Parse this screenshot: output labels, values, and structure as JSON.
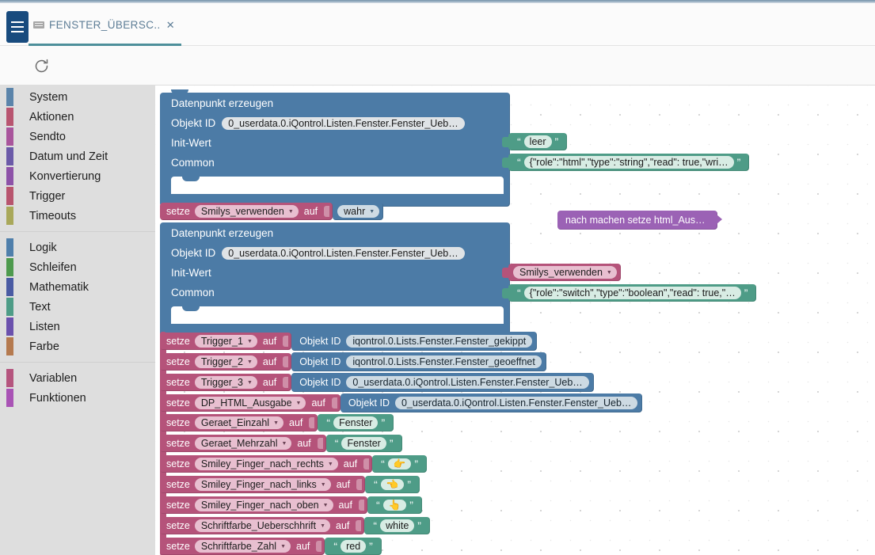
{
  "header": {
    "menu_icon": "hamburger-icon",
    "tab_icon": "script-file-icon",
    "tab_label": "FENSTER_ÜBERSC..",
    "tab_close": "✕",
    "accent_color": "#4d8f9a",
    "menu_color": "#184b7e"
  },
  "toolbar": {
    "refresh_icon": "refresh-icon",
    "refresh_title": "Neu laden"
  },
  "palette": {
    "groups": [
      {
        "items": [
          {
            "label": "System",
            "color": "#5b84aa"
          },
          {
            "label": "Aktionen",
            "color": "#b85570"
          },
          {
            "label": "Sendto",
            "color": "#a9559c"
          },
          {
            "label": "Datum und Zeit",
            "color": "#6b5aa8"
          },
          {
            "label": "Konvertierung",
            "color": "#8d52a8"
          },
          {
            "label": "Trigger",
            "color": "#b8556e"
          },
          {
            "label": "Timeouts",
            "color": "#a9a85a"
          }
        ]
      },
      {
        "items": [
          {
            "label": "Logik",
            "color": "#4f7fab"
          },
          {
            "label": "Schleifen",
            "color": "#4e9a4e"
          },
          {
            "label": "Mathematik",
            "color": "#4a5ba3"
          },
          {
            "label": "Text",
            "color": "#4e9c87"
          },
          {
            "label": "Listen",
            "color": "#6b51ad"
          },
          {
            "label": "Farbe",
            "color": "#b57a4f"
          }
        ]
      },
      {
        "items": [
          {
            "label": "Variablen",
            "color": "#b5557e"
          },
          {
            "label": "Funktionen",
            "color": "#a953b5"
          }
        ]
      }
    ]
  },
  "canvas": {
    "datapoint_block_1": {
      "title": "Datenpunkt erzeugen",
      "rows": [
        {
          "label": "Objekt ID",
          "value": "0_userdata.0.iQontrol.Listen.Fenster.Fenster_Ueb…"
        },
        {
          "label": "Init-Wert",
          "value": ""
        },
        {
          "label": "Common",
          "value": ""
        }
      ],
      "init_value_string": "leer",
      "common_string": "{\"role\":\"html\",\"type\":\"string\",\"read\": true,\"wri…"
    },
    "set_smilys": {
      "keyword": "setze",
      "variable": "Smilys_verwenden",
      "connector": "auf",
      "value": "wahr"
    },
    "on_change_block": {
      "label": "nach machen  setze html_Aus…"
    },
    "datapoint_block_2": {
      "title": "Datenpunkt erzeugen",
      "rows": [
        {
          "label": "Objekt ID",
          "value": "0_userdata.0.iQontrol.Listen.Fenster.Fenster_Ueb…"
        },
        {
          "label": "Init-Wert",
          "value": ""
        },
        {
          "label": "Common",
          "value": ""
        }
      ],
      "init_value_variable": "Smilys_verwenden",
      "common_string": "{\"role\":\"switch\",\"type\":\"boolean\",\"read\": true,\"…"
    },
    "assignments": [
      {
        "keyword": "setze",
        "variable": "Trigger_1",
        "connector": "auf",
        "value_kind": "object-id",
        "object_label": "Objekt ID",
        "value": "iqontrol.0.Lists.Fenster.Fenster_gekippt"
      },
      {
        "keyword": "setze",
        "variable": "Trigger_2",
        "connector": "auf",
        "value_kind": "object-id",
        "object_label": "Objekt ID",
        "value": "iqontrol.0.Lists.Fenster.Fenster_geoeffnet"
      },
      {
        "keyword": "setze",
        "variable": "Trigger_3",
        "connector": "auf",
        "value_kind": "object-id",
        "object_label": "Objekt ID",
        "value": "0_userdata.0.iQontrol.Listen.Fenster.Fenster_Ueb…"
      },
      {
        "keyword": "setze",
        "variable": "DP_HTML_Ausgabe",
        "connector": "auf",
        "value_kind": "object-id",
        "object_label": "Objekt ID",
        "value": "0_userdata.0.iQontrol.Listen.Fenster.Fenster_Ueb…"
      },
      {
        "keyword": "setze",
        "variable": "Geraet_Einzahl",
        "connector": "auf",
        "value_kind": "string",
        "value": "Fenster"
      },
      {
        "keyword": "setze",
        "variable": "Geraet_Mehrzahl",
        "connector": "auf",
        "value_kind": "string",
        "value": "Fenster"
      },
      {
        "keyword": "setze",
        "variable": "Smiley_Finger_nach_rechts",
        "connector": "auf",
        "value_kind": "string",
        "value": "👉"
      },
      {
        "keyword": "setze",
        "variable": "Smiley_Finger_nach_links",
        "connector": "auf",
        "value_kind": "string",
        "value": "👈"
      },
      {
        "keyword": "setze",
        "variable": "Smiley_Finger_nach_oben",
        "connector": "auf",
        "value_kind": "string",
        "value": "👆"
      },
      {
        "keyword": "setze",
        "variable": "Schriftfarbe_Ueberschhrift",
        "connector": "auf",
        "value_kind": "string",
        "value": "white"
      },
      {
        "keyword": "setze",
        "variable": "Schriftfarbe_Zahl",
        "connector": "auf",
        "value_kind": "string",
        "value": "red"
      }
    ],
    "colors": {
      "block_blue": "#4c7ba6",
      "block_rose": "#b5537a",
      "block_teal": "#4e9c87",
      "block_purple": "#9b62b5",
      "canvas_bg": "#ffffff"
    }
  }
}
